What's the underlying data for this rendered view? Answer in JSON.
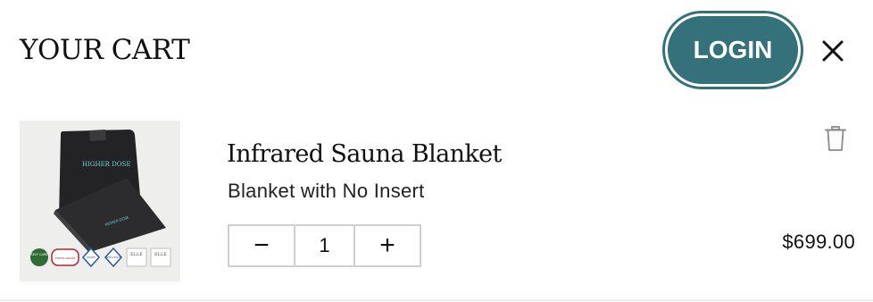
{
  "header": {
    "title": "YOUR CART",
    "login_label": "LOGIN",
    "close_icon": "close-icon"
  },
  "item": {
    "name": "Infrared Sauna Blanket",
    "variant": "Blanket with No Insert",
    "quantity": "1",
    "price": "$699.00",
    "minus_symbol": "−",
    "plus_symbol": "+",
    "trash_icon": "trash-icon",
    "image": {
      "logo_text": "HIGHER DOSE",
      "badges": [
        "SELF CARE",
        "FITNESS AWARDS",
        "SHAPE",
        "MEN'S HEALTH",
        "ELLE",
        "ELLE"
      ]
    }
  },
  "colors": {
    "accent": "#34717a",
    "text": "#111111",
    "border": "#cfcfcf"
  }
}
